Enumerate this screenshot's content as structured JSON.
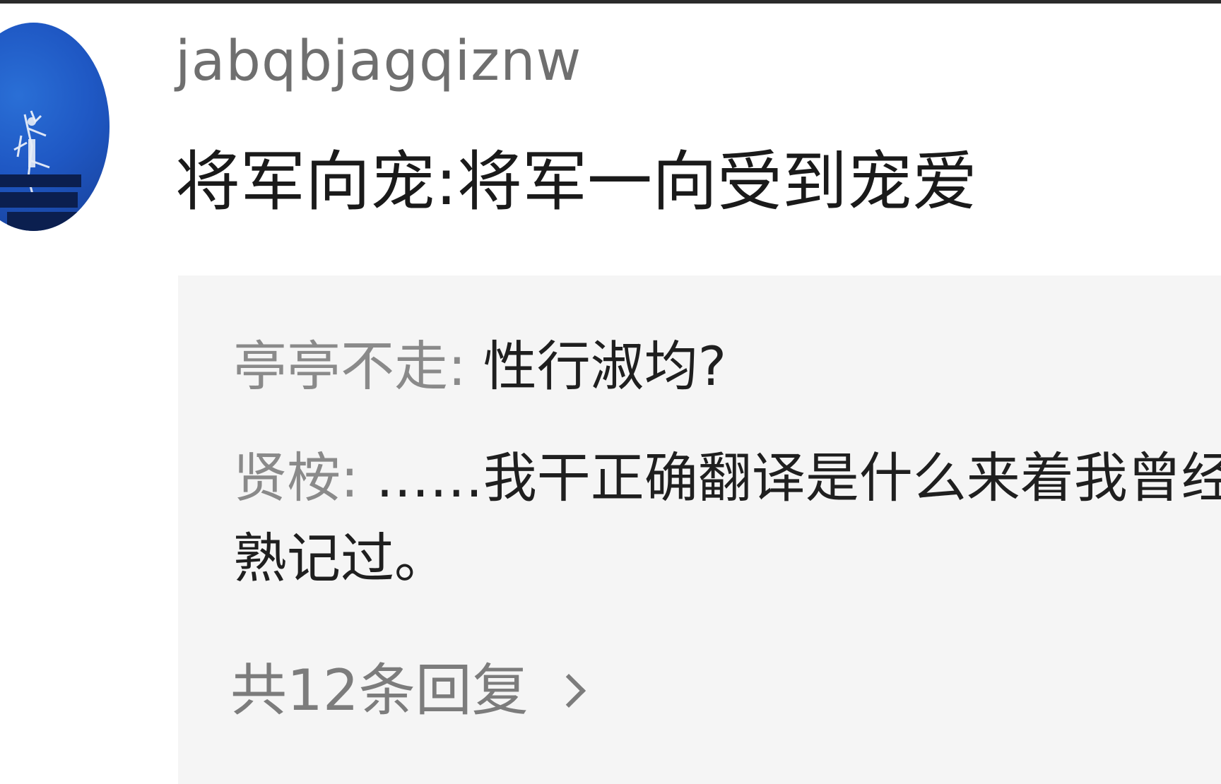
{
  "comment": {
    "username": "jabqbjagqiznw",
    "text": "将军向宠:将军一向受到宠爱"
  },
  "replies": [
    {
      "author": "亭亭不走:",
      "text": " 性行淑均?"
    },
    {
      "author": "贤桉:",
      "text": " ……我干正确翻译是什么来着我曾经熟记过。"
    }
  ],
  "reply_count_label": "共12条回复",
  "icons": {
    "chevron": "chevron-right-icon"
  },
  "colors": {
    "reply_box_bg": "#f5f5f5",
    "avatar_bg": "#1f58c4"
  }
}
